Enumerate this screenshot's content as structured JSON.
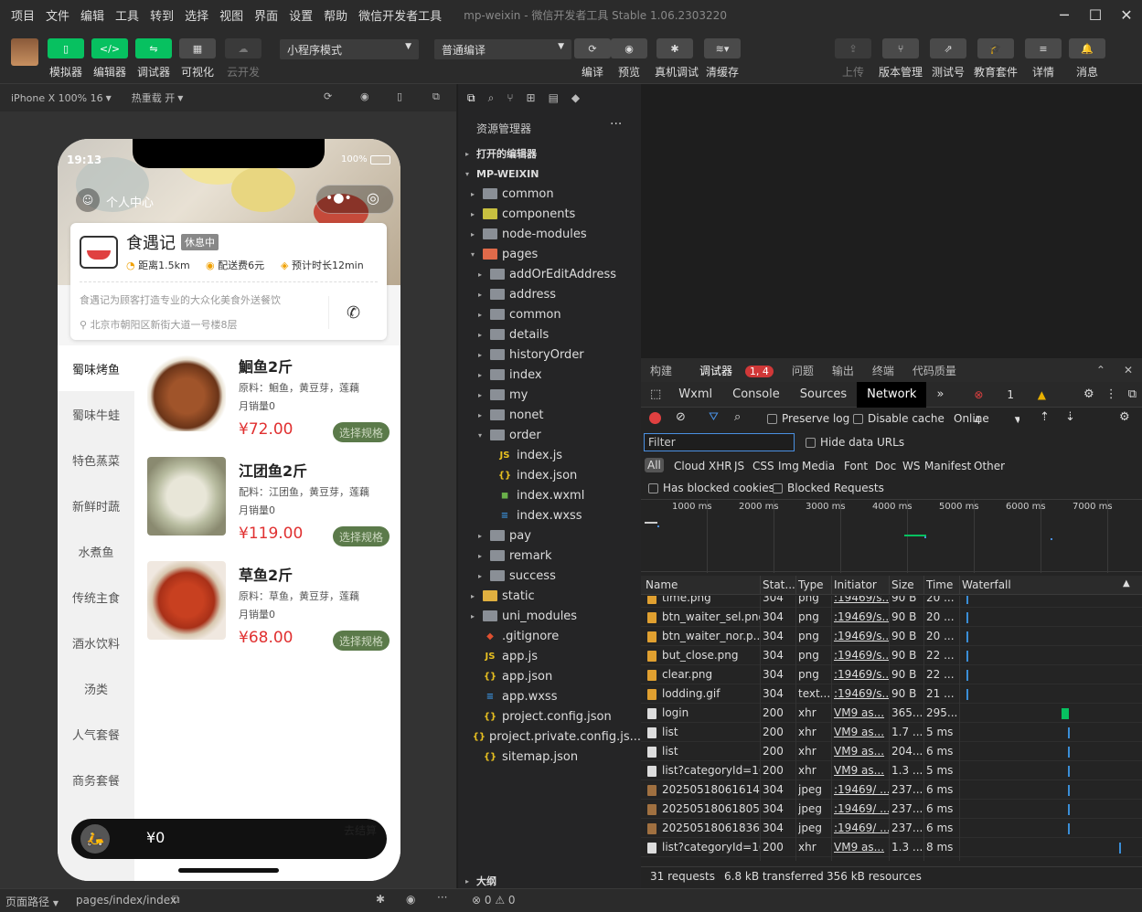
{
  "menu": [
    "项目",
    "文件",
    "编辑",
    "工具",
    "转到",
    "选择",
    "视图",
    "界面",
    "设置",
    "帮助",
    "微信开发者工具"
  ],
  "window_title": "mp-weixin - 微信开发者工具 Stable 1.06.2303220",
  "toolbar": {
    "simulator": "模拟器",
    "editor": "编辑器",
    "debugger": "调试器",
    "visual": "可视化",
    "cloud": "云开发",
    "mode": "小程序模式",
    "compile_mode": "普通编译",
    "compile": "编译",
    "preview": "预览",
    "real_debug": "真机调试",
    "clear_cache": "清缓存",
    "upload": "上传",
    "version": "版本管理",
    "test_account": "测试号",
    "edu": "教育套件",
    "details": "详情",
    "messages": "消息"
  },
  "sim": {
    "device": "iPhone X 100% 16",
    "hot_reload": "热重载 开",
    "time": "19:13",
    "battery": "100%",
    "user_center": "个人中心",
    "shop": {
      "name": "食遇记",
      "status": "休息中",
      "distance": "距离1.5km",
      "delivery_fee": "配送费6元",
      "eta": "预计时长12min",
      "intro": "食遇记为顾客打造专业的大众化美食外送餐饮",
      "address": "北京市朝阳区新街大道一号楼8层"
    },
    "categories": [
      "蜀味烤鱼",
      "蜀味牛蛙",
      "特色蒸菜",
      "新鲜时蔬",
      "水煮鱼",
      "传统主食",
      "酒水饮料",
      "汤类",
      "人气套餐",
      "商务套餐"
    ],
    "goods": [
      {
        "name": "鮰鱼2斤",
        "desc": "原料：鮰鱼，黄豆芽，莲藕",
        "sold": "月销量0",
        "price": "¥72.00",
        "button": "选择规格"
      },
      {
        "name": "江团鱼2斤",
        "desc": "配料：江团鱼，黄豆芽，莲藕",
        "sold": "月销量0",
        "price": "¥119.00",
        "button": "选择规格"
      },
      {
        "name": "草鱼2斤",
        "desc": "原料：草鱼，黄豆芽，莲藕",
        "sold": "月销量0",
        "price": "¥68.00",
        "button": "选择规格"
      }
    ],
    "cart_total": "¥0",
    "checkout": "去结算"
  },
  "explorer": {
    "title": "资源管理器",
    "open_editors": "打开的编辑器",
    "project": "MP-WEIXIN",
    "outline": "大纲",
    "items": [
      {
        "label": "common",
        "depth": 1,
        "kind": "folder",
        "arrow": "▸"
      },
      {
        "label": "components",
        "depth": 1,
        "kind": "folder-c",
        "arrow": "▸"
      },
      {
        "label": "node-modules",
        "depth": 1,
        "kind": "folder",
        "arrow": "▸"
      },
      {
        "label": "pages",
        "depth": 1,
        "kind": "folder-p",
        "arrow": "▾"
      },
      {
        "label": "addOrEditAddress",
        "depth": 2,
        "kind": "folder",
        "arrow": "▸"
      },
      {
        "label": "address",
        "depth": 2,
        "kind": "folder",
        "arrow": "▸"
      },
      {
        "label": "common",
        "depth": 2,
        "kind": "folder",
        "arrow": "▸"
      },
      {
        "label": "details",
        "depth": 2,
        "kind": "folder",
        "arrow": "▸"
      },
      {
        "label": "historyOrder",
        "depth": 2,
        "kind": "folder",
        "arrow": "▸"
      },
      {
        "label": "index",
        "depth": 2,
        "kind": "folder",
        "arrow": "▸"
      },
      {
        "label": "my",
        "depth": 2,
        "kind": "folder",
        "arrow": "▸"
      },
      {
        "label": "nonet",
        "depth": 2,
        "kind": "folder",
        "arrow": "▸"
      },
      {
        "label": "order",
        "depth": 2,
        "kind": "folder-open",
        "arrow": "▾"
      },
      {
        "label": "index.js",
        "depth": 3,
        "kind": "js",
        "arrow": ""
      },
      {
        "label": "index.json",
        "depth": 3,
        "kind": "json",
        "arrow": ""
      },
      {
        "label": "index.wxml",
        "depth": 3,
        "kind": "wxml",
        "arrow": ""
      },
      {
        "label": "index.wxss",
        "depth": 3,
        "kind": "wxss",
        "arrow": ""
      },
      {
        "label": "pay",
        "depth": 2,
        "kind": "folder",
        "arrow": "▸"
      },
      {
        "label": "remark",
        "depth": 2,
        "kind": "folder",
        "arrow": "▸"
      },
      {
        "label": "success",
        "depth": 2,
        "kind": "folder",
        "arrow": "▸"
      },
      {
        "label": "static",
        "depth": 1,
        "kind": "folder-s",
        "arrow": "▸"
      },
      {
        "label": "uni_modules",
        "depth": 1,
        "kind": "folder",
        "arrow": "▸"
      },
      {
        "label": ".gitignore",
        "depth": 1,
        "kind": "git",
        "arrow": ""
      },
      {
        "label": "app.js",
        "depth": 1,
        "kind": "js",
        "arrow": ""
      },
      {
        "label": "app.json",
        "depth": 1,
        "kind": "json",
        "arrow": ""
      },
      {
        "label": "app.wxss",
        "depth": 1,
        "kind": "wxss",
        "arrow": ""
      },
      {
        "label": "project.config.json",
        "depth": 1,
        "kind": "json",
        "arrow": ""
      },
      {
        "label": "project.private.config.js...",
        "depth": 1,
        "kind": "json",
        "arrow": ""
      },
      {
        "label": "sitemap.json",
        "depth": 1,
        "kind": "json",
        "arrow": ""
      }
    ]
  },
  "devtools": {
    "tabs": [
      "构建",
      "调试器",
      "问题",
      "输出",
      "终端",
      "代码质量"
    ],
    "debugger_badge": "1, 4",
    "panels": [
      "Wxml",
      "Console",
      "Sources",
      "Network"
    ],
    "errors": "1",
    "warnings": "4",
    "preserve_log": "Preserve log",
    "disable_cache": "Disable cache",
    "throttle": "Online",
    "filter_placeholder": "Filter",
    "hide_data_urls": "Hide data URLs",
    "types": [
      "All",
      "Cloud",
      "XHR",
      "JS",
      "CSS",
      "Img",
      "Media",
      "Font",
      "Doc",
      "WS",
      "Manifest",
      "Other"
    ],
    "has_blocked_cookies": "Has blocked cookies",
    "blocked_requests": "Blocked Requests",
    "timeline_ticks": [
      "1000 ms",
      "2000 ms",
      "3000 ms",
      "4000 ms",
      "5000 ms",
      "6000 ms",
      "7000 ms"
    ],
    "columns": [
      "Name",
      "Stat...",
      "Type",
      "Initiator",
      "Size",
      "Time",
      "Waterfall"
    ],
    "rows": [
      {
        "name": "time.png",
        "status": "304",
        "type": "png",
        "initiator": ":19469/s...",
        "size": "90 B",
        "time": "20 ...",
        "icon": "img",
        "wf": 0.03
      },
      {
        "name": "btn_waiter_sel.png",
        "status": "304",
        "type": "png",
        "initiator": ":19469/s...",
        "size": "90 B",
        "time": "20 ...",
        "icon": "img",
        "wf": 0.03
      },
      {
        "name": "btn_waiter_nor.p...",
        "status": "304",
        "type": "png",
        "initiator": ":19469/s...",
        "size": "90 B",
        "time": "20 ...",
        "icon": "img",
        "wf": 0.03
      },
      {
        "name": "but_close.png",
        "status": "304",
        "type": "png",
        "initiator": ":19469/s...",
        "size": "90 B",
        "time": "22 ...",
        "icon": "img",
        "wf": 0.03
      },
      {
        "name": "clear.png",
        "status": "304",
        "type": "png",
        "initiator": ":19469/s...",
        "size": "90 B",
        "time": "22 ...",
        "icon": "img",
        "wf": 0.03
      },
      {
        "name": "lodding.gif",
        "status": "304",
        "type": "text...",
        "initiator": ":19469/s...",
        "size": "90 B",
        "time": "21 ...",
        "icon": "img",
        "wf": 0.03
      },
      {
        "name": "login",
        "status": "200",
        "type": "xhr",
        "initiator": "VM9 as...",
        "size": "365...",
        "time": "295...",
        "icon": "doc",
        "wf": 0.62
      },
      {
        "name": "list",
        "status": "200",
        "type": "xhr",
        "initiator": "VM9 as...",
        "size": "1.7 ...",
        "time": "5 ms",
        "icon": "doc",
        "wf": 0.66
      },
      {
        "name": "list",
        "status": "200",
        "type": "xhr",
        "initiator": "VM9 as...",
        "size": "204...",
        "time": "6 ms",
        "icon": "doc",
        "wf": 0.66
      },
      {
        "name": "list?categoryId=16",
        "status": "200",
        "type": "xhr",
        "initiator": "VM9 as...",
        "size": "1.3 ...",
        "time": "5 ms",
        "icon": "doc",
        "wf": 0.66
      },
      {
        "name": "20250518061614...",
        "status": "304",
        "type": "jpeg",
        "initiator": ":19469/ ...",
        "size": "237...",
        "time": "6 ms",
        "icon": "jpg",
        "wf": 0.66
      },
      {
        "name": "20250518061805...",
        "status": "304",
        "type": "jpeg",
        "initiator": ":19469/ ...",
        "size": "237...",
        "time": "6 ms",
        "icon": "jpg",
        "wf": 0.66
      },
      {
        "name": "20250518061836...",
        "status": "304",
        "type": "jpeg",
        "initiator": ":19469/ ...",
        "size": "237...",
        "time": "6 ms",
        "icon": "jpg",
        "wf": 0.66
      },
      {
        "name": "list?categoryId=16",
        "status": "200",
        "type": "xhr",
        "initiator": "VM9 as...",
        "size": "1.3 ...",
        "time": "8 ms",
        "icon": "doc",
        "wf": 0.98
      }
    ],
    "summary": {
      "requests": "31 requests",
      "transferred": "6.8 kB transferred",
      "resources": "356 kB resources"
    }
  },
  "status": {
    "page_path_label": "页面路径",
    "page_path": "pages/index/index",
    "errors": "0",
    "warnings": "0"
  },
  "colors": {
    "accent": "#07c160",
    "price": "#e03030",
    "spec_button": "#5b7a4a",
    "error": "#e04040",
    "warning": "#e8b000"
  }
}
